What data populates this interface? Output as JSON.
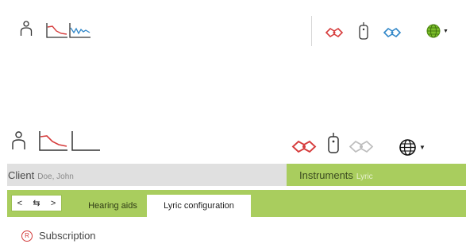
{
  "toolbar_top": {
    "icons": [
      "person-icon",
      "audiogram-red-icon",
      "audiogram-blue-icon",
      "hearing-aid-left-icon",
      "remote-control-icon",
      "hearing-aid-right-icon",
      "globe-icon"
    ],
    "colors": {
      "red": "#d63b3b",
      "blue": "#2f86c8",
      "globe_green": "#7cbf2a"
    }
  },
  "toolbar_bottom": {
    "icons": [
      "person-icon",
      "audiogram-red-icon",
      "audiogram-empty-icon",
      "hearing-aid-left-icon",
      "remote-control-icon",
      "hearing-aid-right-disabled-icon",
      "globe-icon"
    ]
  },
  "client": {
    "label": "Client",
    "name": "Doe, John"
  },
  "instruments": {
    "label": "Instruments",
    "name": "Lyric"
  },
  "nav": {
    "back": "<",
    "swap": "⇆",
    "forward": ">"
  },
  "tabs": [
    {
      "label": "Hearing aids",
      "active": false
    },
    {
      "label": "Lyric configuration",
      "active": true
    }
  ],
  "subscription": {
    "icon_text": "R",
    "label": "Subscription"
  },
  "colors": {
    "green_bar": "#a9cd5e",
    "gray_bar": "#e0e0e0"
  }
}
